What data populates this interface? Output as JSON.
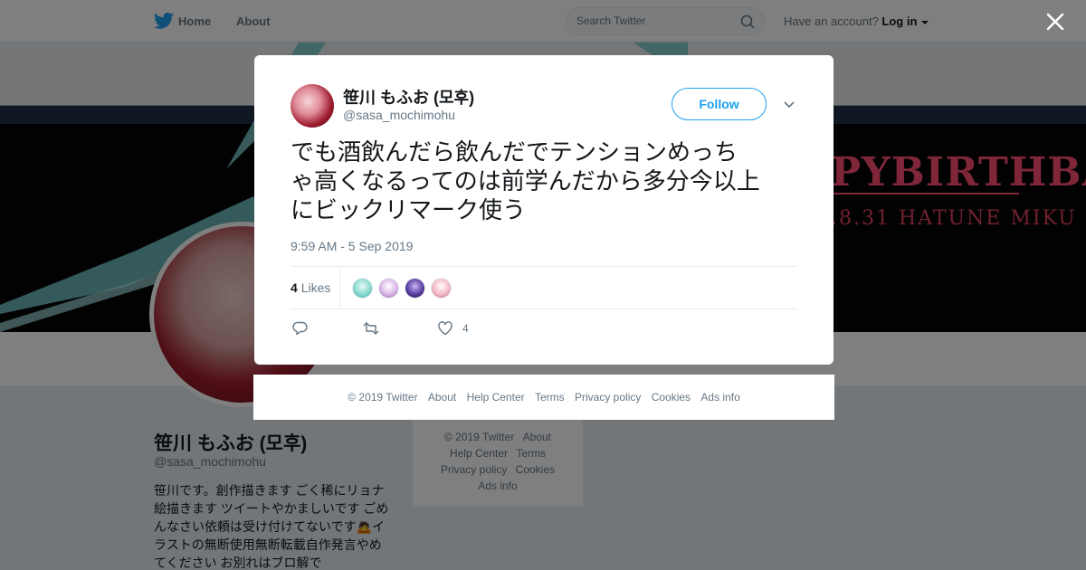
{
  "topnav": {
    "home_label": "Home",
    "about_label": "About",
    "search_placeholder": "Search Twitter",
    "have_account_text": "Have an account?",
    "login_label": "Log in"
  },
  "banner": {
    "birthday_text": "PYBIRTHBAY!",
    "sub_text": ".8.31  HATUNE MIKU"
  },
  "profile": {
    "name": "笹川 もふお (모후)",
    "handle": "@sasa_mochimohu",
    "bio_lines": [
      "笹川です。創作描きます ごく稀にリョナ",
      "絵描きます ツイートやかましいです ごめ",
      "んなさい依頼は受け付けてないです🙇イ",
      "ラストの無断使用無断転載自作発言やめ",
      "てください お別れはブロ解で"
    ]
  },
  "side_footer": {
    "copyright": "© 2019 Twitter",
    "about": "About",
    "help_center": "Help Center",
    "terms": "Terms",
    "privacy": "Privacy policy",
    "cookies": "Cookies",
    "ads_info": "Ads info"
  },
  "tweet": {
    "author_name": "笹川 もふお (모후)",
    "author_handle": "@sasa_mochimohu",
    "follow_label": "Follow",
    "text_lines": [
      "でも酒飲んだら飲んだでテンションめっち",
      "ゃ高くなるってのは前学んだから多分今以上",
      "にビックリマーク使う"
    ],
    "timestamp": "9:59 AM - 5 Sep 2019",
    "likes_count": "4",
    "likes_label": "Likes",
    "like_action_count": "4"
  },
  "modal_footer": {
    "copyright": "© 2019 Twitter",
    "about": "About",
    "help_center": "Help Center",
    "terms": "Terms",
    "privacy": "Privacy policy",
    "cookies": "Cookies",
    "ads_info": "Ads info"
  },
  "colors": {
    "twitter_blue": "#1da1f2",
    "text_primary": "#14171a",
    "text_secondary": "#657786"
  }
}
